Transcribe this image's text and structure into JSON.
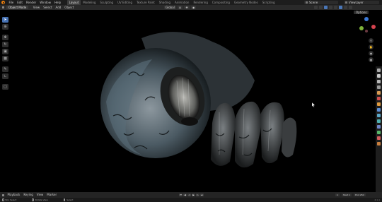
{
  "topbar": {
    "menus": [
      "File",
      "Edit",
      "Render",
      "Window",
      "Help"
    ],
    "tabs": [
      "Layout",
      "Modeling",
      "Sculpting",
      "UV Editing",
      "Texture Paint",
      "Shading",
      "Animation",
      "Rendering",
      "Compositing",
      "Geometry Nodes",
      "Scripting"
    ],
    "active_tab": "Layout",
    "scene": "Scene",
    "view_layer": "ViewLayer"
  },
  "viewport_header": {
    "mode": "Object Mode",
    "menus": [
      "View",
      "Select",
      "Add",
      "Object"
    ],
    "transform_orientation": "Global",
    "options_label": "Options"
  },
  "timeline": {
    "menus": [
      "Playback",
      "Keying",
      "View",
      "Marker"
    ],
    "current_frame": "1",
    "start_label": "Start",
    "start": "1",
    "end_label": "End",
    "end": "250"
  },
  "statusbar": {
    "items": [
      "Box Select",
      "Rotate View",
      "Select"
    ],
    "version": "4.1.1"
  },
  "colors": {
    "accent": "#4772b3",
    "logo": "#e87d0d",
    "axis_x": "#d6434f",
    "axis_y": "#7fb33a",
    "axis_z": "#3b79d8"
  },
  "icons": {
    "toolbar": [
      "cursor-select-icon",
      "cursor-3d-icon",
      "move-icon",
      "rotate-icon",
      "scale-icon",
      "transform-icon",
      "annotate-icon",
      "measure-icon",
      "add-cube-icon"
    ],
    "nav": [
      "zoom-icon",
      "pan-hand-icon",
      "camera-icon",
      "grid-icon"
    ],
    "properties": [
      "tool-icon",
      "render-icon",
      "output-icon",
      "view-layer-icon",
      "scene-icon",
      "world-icon",
      "object-icon",
      "modifier-icon",
      "particles-icon",
      "physics-icon",
      "constraints-icon",
      "data-icon",
      "material-icon",
      "texture-icon"
    ]
  }
}
